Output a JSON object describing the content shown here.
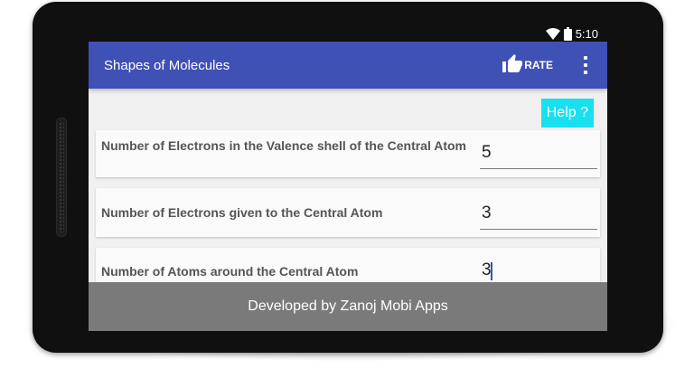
{
  "status_bar": {
    "time": "5:10"
  },
  "app_bar": {
    "title": "Shapes of Molecules",
    "rate_label": "RATE"
  },
  "help_button": {
    "label": "Help ?"
  },
  "fields": [
    {
      "label": "Number of Electrons in the Valence shell of the Central Atom",
      "value": "5"
    },
    {
      "label": "Number of Electrons given to the Central Atom",
      "value": "3"
    },
    {
      "label": "Number of Atoms around the Central Atom",
      "value": "3"
    }
  ],
  "footer": {
    "text": "Developed by Zanoj Mobi Apps"
  },
  "colors": {
    "app_bar": "#3f51b5",
    "help_button": "#18e0ee",
    "footer": "#7a7a7a",
    "screen_bg": "#f0f0f0"
  }
}
